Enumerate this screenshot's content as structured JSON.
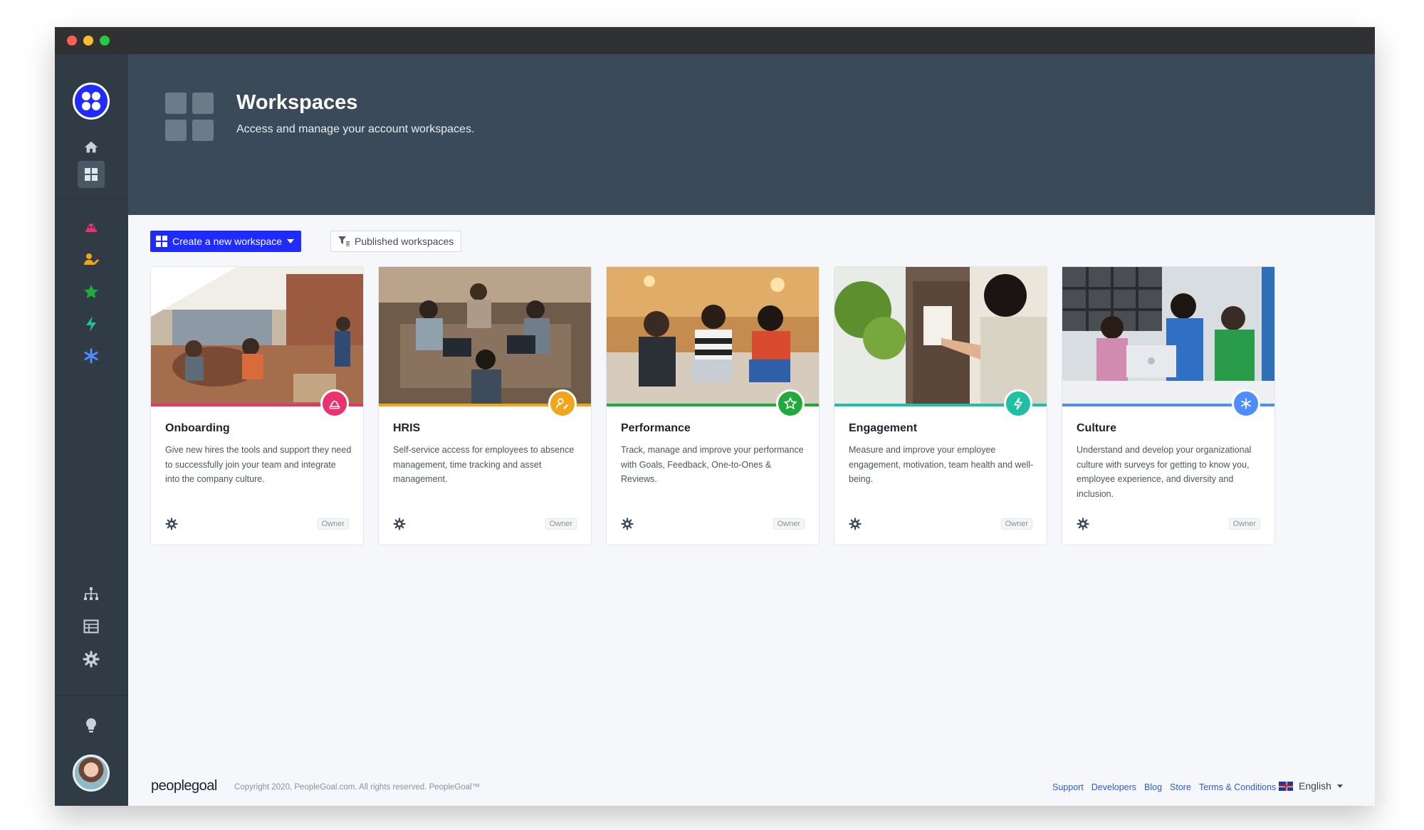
{
  "window": {
    "controls": [
      "close",
      "minimize",
      "zoom"
    ]
  },
  "sidebar": {
    "top_items": [
      {
        "name": "home-icon",
        "color": "#c9d1d9"
      },
      {
        "name": "workspaces-icon",
        "color": "#c9d1d9",
        "active": true
      }
    ],
    "workspace_items": [
      {
        "name": "onboarding-icon",
        "color": "#e8336f"
      },
      {
        "name": "hris-icon",
        "color": "#f0a51a"
      },
      {
        "name": "performance-icon",
        "color": "#1faa3b"
      },
      {
        "name": "engagement-icon",
        "color": "#1fbfa3"
      },
      {
        "name": "culture-icon",
        "color": "#4d8dff"
      }
    ],
    "bottom_items": [
      {
        "name": "org-chart-icon"
      },
      {
        "name": "table-icon"
      },
      {
        "name": "settings-icon"
      },
      {
        "name": "lightbulb-icon"
      },
      {
        "name": "bell-icon"
      }
    ]
  },
  "header": {
    "title": "Workspaces",
    "subtitle": "Access and manage your account workspaces."
  },
  "toolbar": {
    "create_label": "Create a new workspace",
    "published_label": "Published workspaces"
  },
  "cards": [
    {
      "title": "Onboarding",
      "description": "Give new hires the tools and support they need to successfully join your team and integrate into the company culture.",
      "accent": "#e8336f",
      "icon": "onboarding-icon",
      "role": "Owner"
    },
    {
      "title": "HRIS",
      "description": "Self-service access for employees to absence management, time tracking and asset management.",
      "accent": "#f0a51a",
      "icon": "hris-icon",
      "role": "Owner"
    },
    {
      "title": "Performance",
      "description": "Track, manage and improve your performance with Goals, Feedback, One-to-Ones & Reviews.",
      "accent": "#1faa3b",
      "icon": "performance-icon",
      "role": "Owner"
    },
    {
      "title": "Engagement",
      "description": "Measure and improve your employee engagement, motivation, team health and well-being.",
      "accent": "#1fbfa3",
      "icon": "engagement-icon",
      "role": "Owner"
    },
    {
      "title": "Culture",
      "description": "Understand and develop your organizational culture with surveys for getting to know you, employee experience, and diversity and inclusion.",
      "accent": "#4d8dff",
      "icon": "culture-icon",
      "role": "Owner"
    }
  ],
  "footer": {
    "brand": "peoplegoal",
    "copyright": "Copyright 2020, PeopleGoal.com. All rights reserved. PeopleGoal™",
    "links": [
      "Support",
      "Developers",
      "Blog",
      "Store",
      "Terms & Conditions"
    ],
    "language": "English"
  }
}
